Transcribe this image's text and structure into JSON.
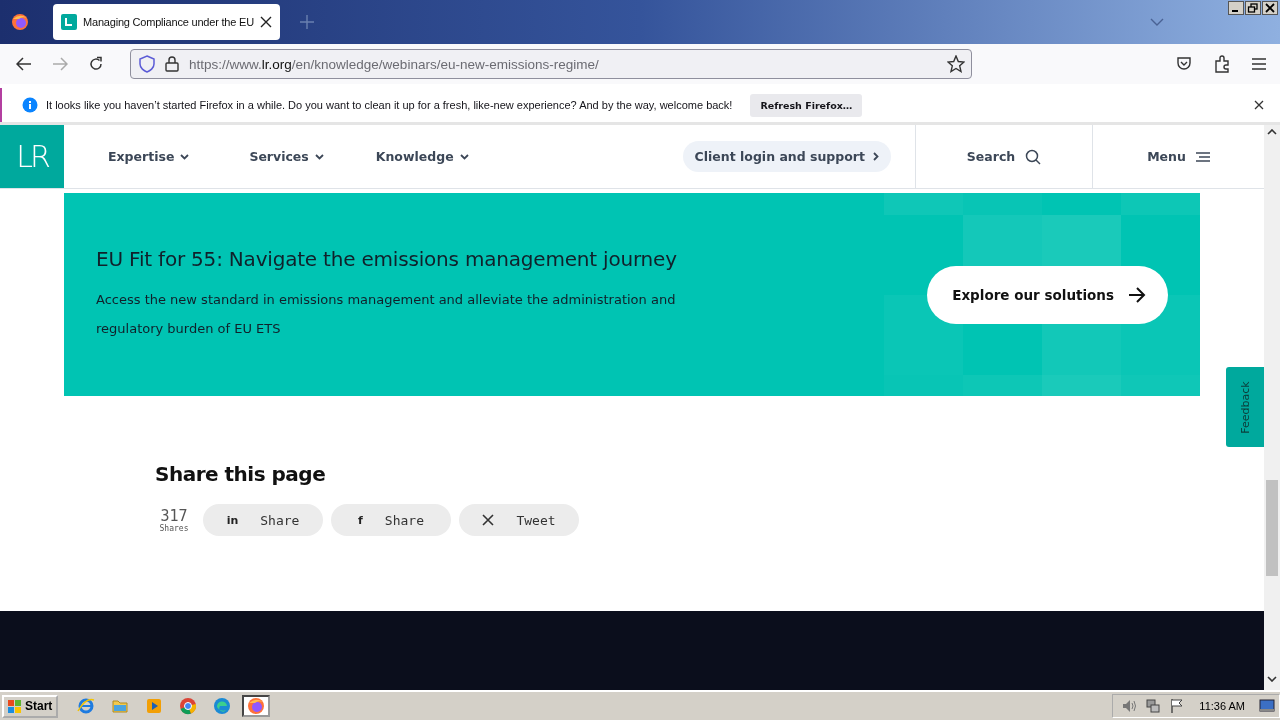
{
  "browser": {
    "tabs": [
      {
        "title": "Managing Compliance under the EU",
        "selected": true
      }
    ],
    "url": {
      "scheme": "https://www.",
      "host": "lr.org",
      "path": "/en/knowledge/webinars/eu-new-emissions-regime/"
    },
    "notification": {
      "text": "It looks like you haven’t started Firefox in a while. Do you want to clean it up for a fresh, like-new experience? And by the way, welcome back!",
      "button": "Refresh Firefox…"
    }
  },
  "header": {
    "logo": "LR",
    "nav": [
      {
        "label": "Expertise"
      },
      {
        "label": "Services"
      },
      {
        "label": "Knowledge"
      }
    ],
    "client_login": "Client login and support",
    "search": "Search",
    "menu": "Menu"
  },
  "banner": {
    "title": "EU Fit for 55: Navigate the emissions management journey",
    "text": "Access the new standard in emissions management and alleviate the administration and regulatory burden of EU ETS",
    "button": "Explore our solutions"
  },
  "share": {
    "heading": "Share this page",
    "count": "317",
    "count_label": "Shares",
    "buttons": [
      {
        "kind": "linkedin",
        "icon": "in",
        "label": "Share"
      },
      {
        "kind": "facebook",
        "icon": "f",
        "label": "Share"
      },
      {
        "kind": "x",
        "label": "Tweet"
      }
    ]
  },
  "feedback": "Feedback",
  "taskbar": {
    "start": "Start",
    "apps": [
      {
        "kind": "ie",
        "selected": false
      },
      {
        "kind": "folder",
        "selected": false
      },
      {
        "kind": "media",
        "selected": false
      },
      {
        "kind": "chrome",
        "selected": false
      },
      {
        "kind": "edge",
        "selected": false
      },
      {
        "kind": "firefox",
        "selected": true
      }
    ],
    "clock": "11:36 AM"
  }
}
